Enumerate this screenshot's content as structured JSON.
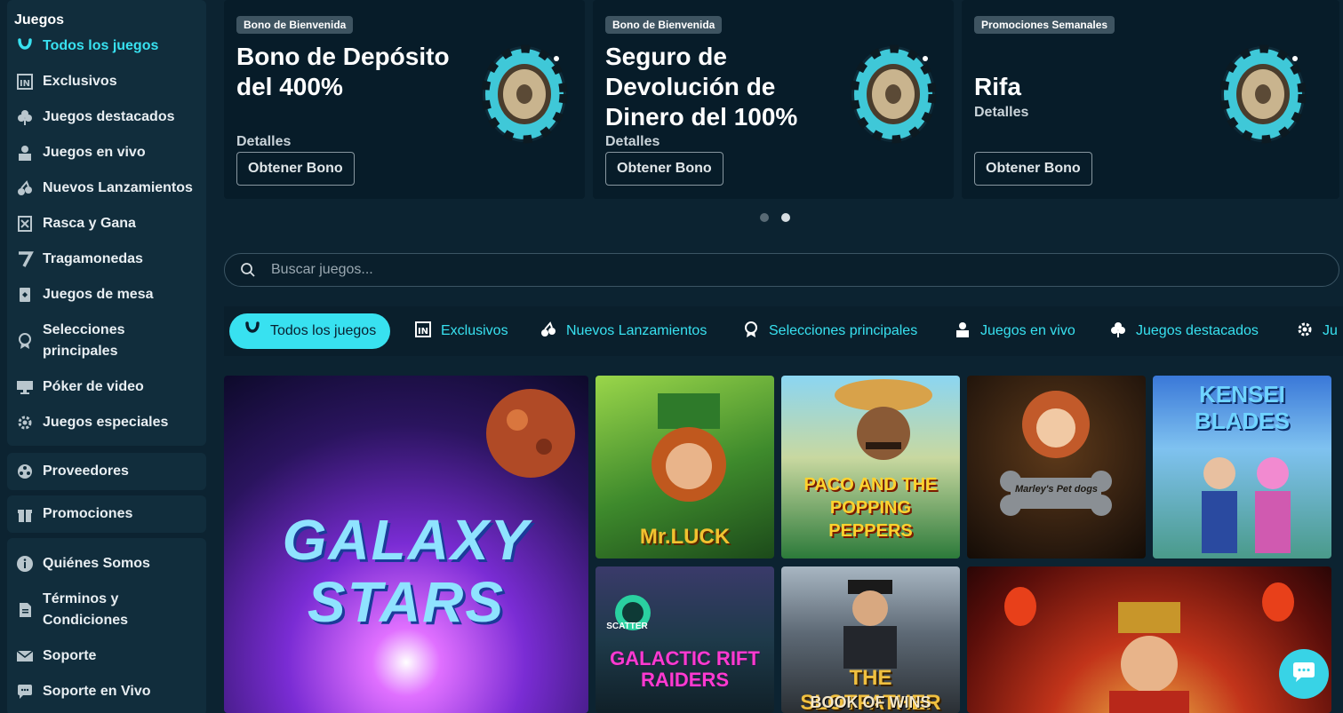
{
  "sidebar": {
    "section_title": "Juegos",
    "items": [
      {
        "label": "Todos los juegos",
        "icon": "horseshoe-icon"
      },
      {
        "label": "Exclusivos",
        "icon": "in-badge-icon"
      },
      {
        "label": "Juegos destacados",
        "icon": "clover-icon"
      },
      {
        "label": "Juegos en vivo",
        "icon": "dealer-icon"
      },
      {
        "label": "Nuevos Lanzamientos",
        "icon": "cherries-icon"
      },
      {
        "label": "Rasca y Gana",
        "icon": "scratch-card-icon"
      },
      {
        "label": "Tragamonedas",
        "icon": "seven-icon"
      },
      {
        "label": "Juegos de mesa",
        "icon": "cards-icon"
      },
      {
        "label": "Selecciones principales",
        "icon": "award-icon"
      },
      {
        "label": "Póker de video",
        "icon": "video-poker-icon"
      },
      {
        "label": "Juegos especiales",
        "icon": "gear-icon"
      }
    ],
    "providers": {
      "label": "Proveedores",
      "icon": "providers-icon"
    },
    "promotions": {
      "label": "Promociones",
      "icon": "gift-icon"
    },
    "info": [
      {
        "label": "Quiénes Somos",
        "icon": "info-icon"
      },
      {
        "label": "Términos y Condiciones",
        "icon": "document-icon"
      },
      {
        "label": "Soporte",
        "icon": "mail-icon"
      },
      {
        "label": "Soporte en Vivo",
        "icon": "chat-bubble-icon"
      }
    ]
  },
  "promos": [
    {
      "badge": "Bono de Bienvenida",
      "title": "Bono de Depósito del 400%",
      "details": "Detalles",
      "button": "Obtener Bono",
      "icon": "poker-chip-icon"
    },
    {
      "badge": "Bono de Bienvenida",
      "title": "Seguro de Devolución de Dinero del 100%",
      "details": "Detalles",
      "button": "Obtener Bono",
      "icon": "poker-chip-icon"
    },
    {
      "badge": "Promociones Semanales",
      "title": "Rifa",
      "details": "Detalles",
      "button": "Obtener Bono",
      "icon": "poker-chip-icon"
    }
  ],
  "carousel": {
    "pages": 2,
    "active": 2
  },
  "search": {
    "placeholder": "Buscar juegos..."
  },
  "tabs": [
    {
      "label": "Todos los juegos",
      "icon": "horseshoe-icon",
      "active": true
    },
    {
      "label": "Exclusivos",
      "icon": "in-badge-icon"
    },
    {
      "label": "Nuevos Lanzamientos",
      "icon": "cherries-icon"
    },
    {
      "label": "Selecciones principales",
      "icon": "award-icon"
    },
    {
      "label": "Juegos en vivo",
      "icon": "dealer-icon"
    },
    {
      "label": "Juegos destacados",
      "icon": "clover-icon"
    },
    {
      "label": "Ju",
      "icon": "gear-icon"
    }
  ],
  "games": [
    {
      "title": "GALAXY STARS"
    },
    {
      "title": "Mr.LUCK"
    },
    {
      "title": "PACO AND THE POPPING PEPPERS"
    },
    {
      "title": "Marley's Pet dogs"
    },
    {
      "title": "KENSEI BLADES"
    },
    {
      "title": "SCATTER"
    },
    {
      "title": "GALACTIC RIFT RAIDERS"
    },
    {
      "title": "THE SLOTFATHER"
    },
    {
      "title": "BOOK OF WINS"
    }
  ],
  "colors": {
    "accent": "#38e1f0",
    "background": "#0c2331",
    "panel": "#112d3c",
    "card": "#071c29"
  }
}
